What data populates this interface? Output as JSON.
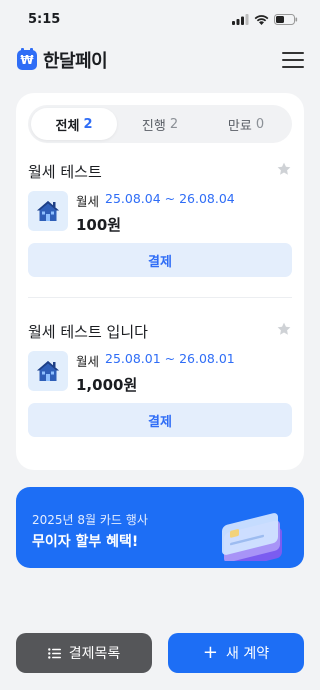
{
  "status_bar": {
    "time": "5:15"
  },
  "header": {
    "logo_text": "₩",
    "app_name": "한달페이"
  },
  "tabs": [
    {
      "label": "전체",
      "count": "2",
      "active": true
    },
    {
      "label": "진행",
      "count": "2",
      "active": false
    },
    {
      "label": "만료",
      "count": "0",
      "active": false
    }
  ],
  "contracts": [
    {
      "title": "월세 테스트",
      "type": "월세",
      "period": "25.08.04 ~ 26.08.04",
      "amount": "100원",
      "pay_label": "결제"
    },
    {
      "title": "월세 테스트 입니다",
      "type": "월세",
      "period": "25.08.01 ~ 26.08.01",
      "amount": "1,000원",
      "pay_label": "결제"
    }
  ],
  "promo": {
    "subtitle": "2025년 8월 카드 행사",
    "title": "무이자 할부 혜택!"
  },
  "bottom": {
    "history_label": "결제목록",
    "new_label": "새 계약"
  },
  "colors": {
    "accent": "#1d6ef5",
    "light_accent": "#e4eefc",
    "dark_button": "#555659"
  }
}
